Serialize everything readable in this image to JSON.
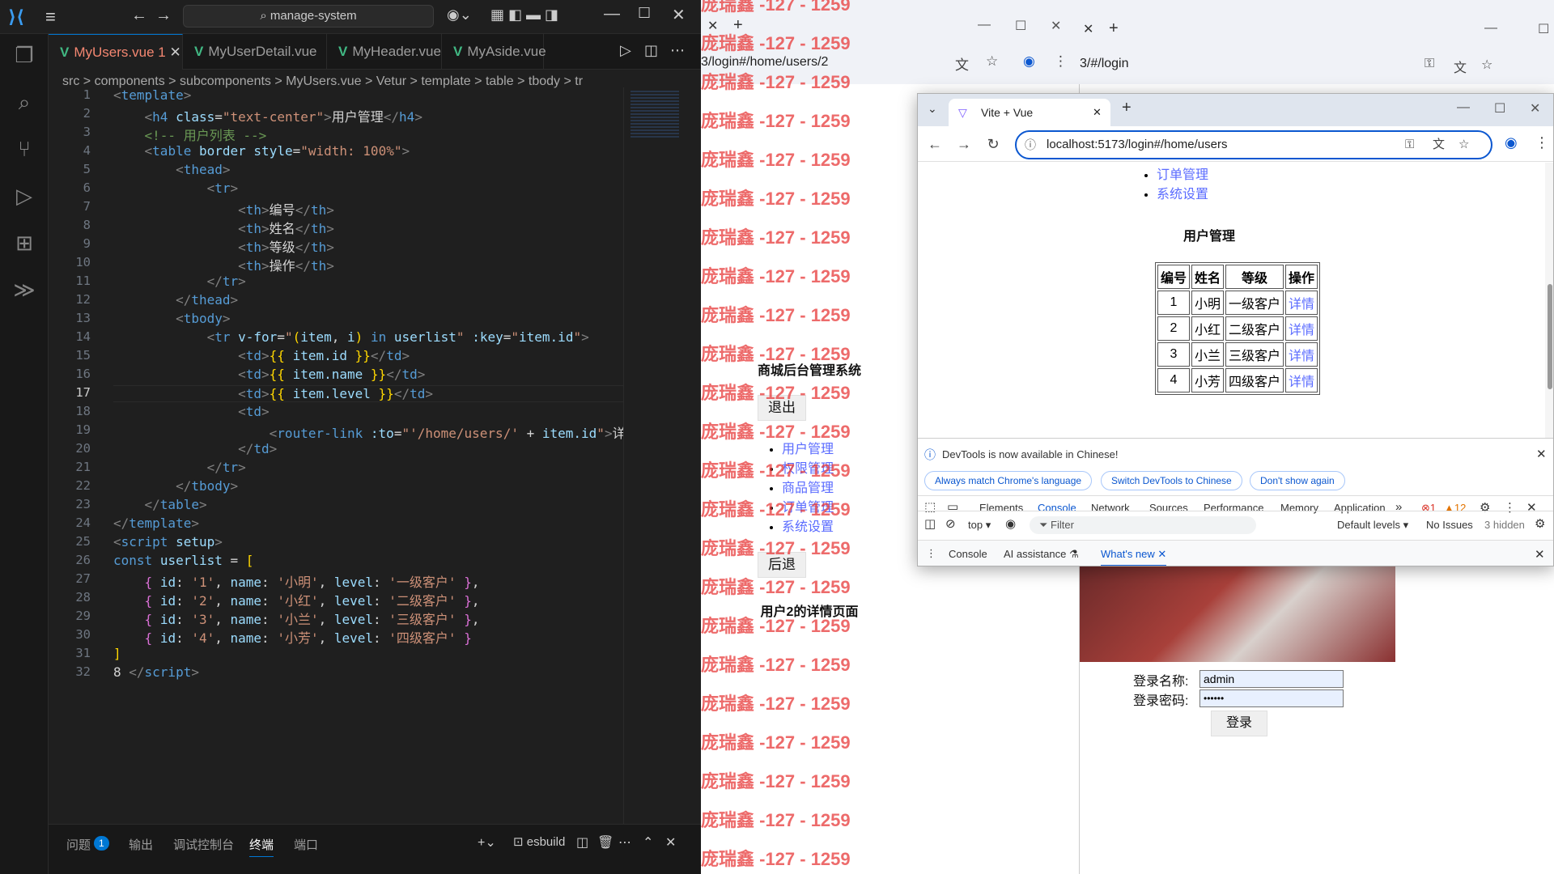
{
  "vscode": {
    "search": "manage-system",
    "tabs": [
      {
        "label": "MyUsers.vue 1",
        "active": true
      },
      {
        "label": "MyUserDetail.vue"
      },
      {
        "label": "MyHeader.vue"
      },
      {
        "label": "MyAside.vue"
      }
    ],
    "breadcrumb": "src > components > subcomponents > MyUsers.vue > Vetur > template > table > tbody > tr",
    "panel_tabs": [
      "问题",
      "输出",
      "调试控制台",
      "终端",
      "端口"
    ],
    "problems_count": "1",
    "terminal_name": "esbuild",
    "current_line": 17
  },
  "browser_back": {
    "url": "3/login#/home/users/2",
    "watermark": "庞瑞鑫 -127 - 1259",
    "site_title": "商城后台管理系统",
    "logout": "退出",
    "menu": [
      "用户管理",
      "权限管理",
      "商品管理",
      "订单管理",
      "系统设置"
    ],
    "back": "后退",
    "detail_text": "用户2的详情页面"
  },
  "browser_right": {
    "url": "3/#/login",
    "login_name_label": "登录名称:",
    "login_name_value": "admin",
    "login_pwd_label": "登录密码:",
    "login_pwd_value": "••••••",
    "login_button": "登录"
  },
  "browser_front": {
    "tab_title": "Vite + Vue",
    "url": "localhost:5173/login#/home/users",
    "menu_visible": [
      "订单管理",
      "系统设置"
    ],
    "heading": "用户管理",
    "table": {
      "headers": [
        "编号",
        "姓名",
        "等级",
        "操作"
      ],
      "rows": [
        [
          "1",
          "小明",
          "一级客户",
          "详情"
        ],
        [
          "2",
          "小红",
          "二级客户",
          "详情"
        ],
        [
          "3",
          "小兰",
          "三级客户",
          "详情"
        ],
        [
          "4",
          "小芳",
          "四级客户",
          "详情"
        ]
      ]
    },
    "devtools": {
      "notice": "DevTools is now available in Chinese!",
      "btn_match": "Always match Chrome's language",
      "btn_switch": "Switch DevTools to Chinese",
      "btn_dont": "Don't show again",
      "tabs": [
        "Elements",
        "Console",
        "Network",
        "Sources",
        "Performance",
        "Memory",
        "Application"
      ],
      "errors": "1",
      "warnings": "12",
      "context": "top",
      "filter": "Filter",
      "levels": "Default levels",
      "issues": "No Issues",
      "hidden": "3 hidden",
      "drawer_tabs": [
        "Console",
        "AI assistance",
        "What's new"
      ]
    }
  }
}
